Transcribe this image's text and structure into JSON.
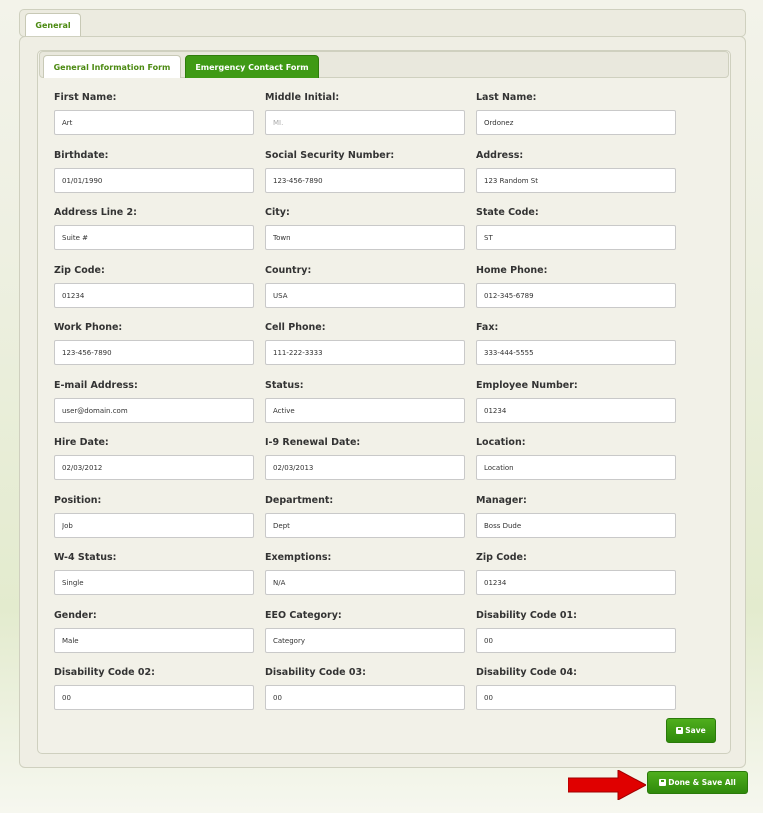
{
  "outer_tabs": [
    "General"
  ],
  "inner_tabs": [
    "General Information Form",
    "Emergency Contact Form"
  ],
  "fields": [
    {
      "label": "First Name:",
      "value": "Art",
      "placeholder": ""
    },
    {
      "label": "Middle Initial:",
      "value": "",
      "placeholder": "MI."
    },
    {
      "label": "Last Name:",
      "value": "Ordonez",
      "placeholder": ""
    },
    {
      "label": "Birthdate:",
      "value": "01/01/1990",
      "placeholder": ""
    },
    {
      "label": "Social Security Number:",
      "value": "123-456-7890",
      "placeholder": ""
    },
    {
      "label": "Address:",
      "value": "123 Random St",
      "placeholder": ""
    },
    {
      "label": "Address Line 2:",
      "value": "Suite #",
      "placeholder": ""
    },
    {
      "label": "City:",
      "value": "Town",
      "placeholder": ""
    },
    {
      "label": "State Code:",
      "value": "ST",
      "placeholder": ""
    },
    {
      "label": "Zip Code:",
      "value": "01234",
      "placeholder": ""
    },
    {
      "label": "Country:",
      "value": "USA",
      "placeholder": ""
    },
    {
      "label": "Home Phone:",
      "value": "012-345-6789",
      "placeholder": ""
    },
    {
      "label": "Work Phone:",
      "value": "123-456-7890",
      "placeholder": ""
    },
    {
      "label": "Cell Phone:",
      "value": "111-222-3333",
      "placeholder": ""
    },
    {
      "label": "Fax:",
      "value": "333-444-5555",
      "placeholder": ""
    },
    {
      "label": "E-mail Address:",
      "value": "user@domain.com",
      "placeholder": ""
    },
    {
      "label": "Status:",
      "value": "Active",
      "placeholder": ""
    },
    {
      "label": "Employee Number:",
      "value": "01234",
      "placeholder": ""
    },
    {
      "label": "Hire Date:",
      "value": "02/03/2012",
      "placeholder": ""
    },
    {
      "label": "I-9 Renewal Date:",
      "value": "02/03/2013",
      "placeholder": ""
    },
    {
      "label": "Location:",
      "value": "Location",
      "placeholder": ""
    },
    {
      "label": "Position:",
      "value": "Job",
      "placeholder": ""
    },
    {
      "label": "Department:",
      "value": "Dept",
      "placeholder": ""
    },
    {
      "label": "Manager:",
      "value": "Boss Dude",
      "placeholder": ""
    },
    {
      "label": "W-4 Status:",
      "value": "Single",
      "placeholder": ""
    },
    {
      "label": "Exemptions:",
      "value": "N/A",
      "placeholder": ""
    },
    {
      "label": "Zip Code:",
      "value": "01234",
      "placeholder": ""
    },
    {
      "label": "Gender:",
      "value": "Male",
      "placeholder": ""
    },
    {
      "label": "EEO Category:",
      "value": "Category",
      "placeholder": ""
    },
    {
      "label": "Disability Code 01:",
      "value": "00",
      "placeholder": ""
    },
    {
      "label": "Disability Code 02:",
      "value": "00",
      "placeholder": ""
    },
    {
      "label": "Disability Code 03:",
      "value": "00",
      "placeholder": ""
    },
    {
      "label": "Disability Code 04:",
      "value": "00",
      "placeholder": ""
    }
  ],
  "buttons": {
    "save": "Save",
    "done_save_all": "Done & Save All",
    "save_icon": "save-disk-icon"
  },
  "colors": {
    "accent_green": "#3f9a15",
    "arrow_red": "#e00000"
  }
}
